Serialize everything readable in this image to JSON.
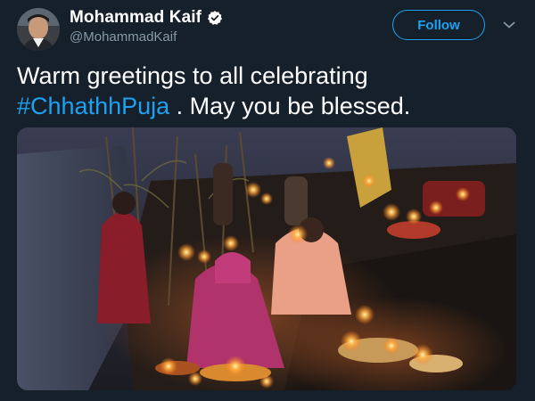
{
  "tweet": {
    "author": {
      "display_name": "Mohammad Kaif",
      "handle": "@MohammadKaif",
      "verified": true
    },
    "follow_label": "Follow",
    "text_before": "Warm greetings to all celebrating ",
    "hashtag": "#ChhathhPuja",
    "text_after": " . May you be blessed."
  },
  "colors": {
    "background": "#15202b",
    "accent": "#1da1f2",
    "secondary_text": "#8899a6"
  },
  "icons": [
    "verified-badge-icon",
    "chevron-down-icon"
  ]
}
